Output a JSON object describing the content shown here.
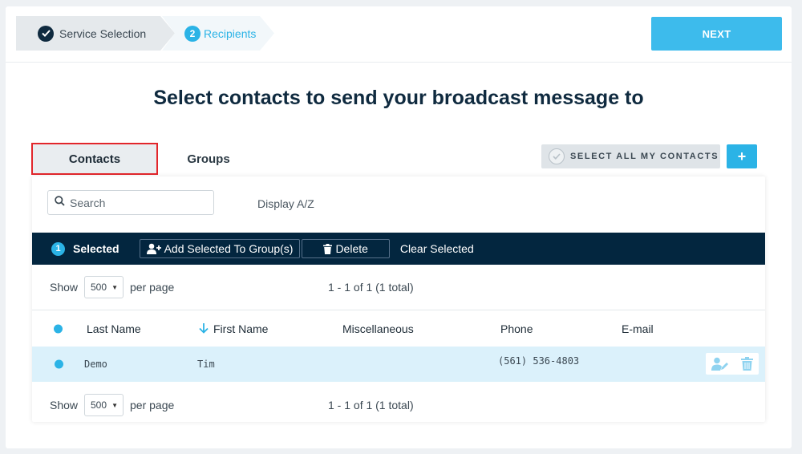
{
  "stepper": {
    "step1_label": "Service Selection",
    "step2_number": "2",
    "step2_label": "Recipients"
  },
  "header": {
    "next_label": "NEXT"
  },
  "title": "Select contacts to send your broadcast message to",
  "tabs": {
    "contacts": "Contacts",
    "groups": "Groups"
  },
  "select_all_label": "SELECT ALL MY CONTACTS",
  "plus_label": "+",
  "search": {
    "placeholder": "Search",
    "display_az": "Display A/Z"
  },
  "actionbar": {
    "selected_count": "1",
    "selected_label": "Selected",
    "add_to_group": "Add Selected To Group(s)",
    "delete": "Delete",
    "clear": "Clear Selected"
  },
  "pager": {
    "show": "Show",
    "per_page_value": "500",
    "per_page": "per page",
    "range": "1 - 1 of 1 (1 total)"
  },
  "table": {
    "columns": [
      "Last Name",
      "First Name",
      "Miscellaneous",
      "Phone",
      "E-mail"
    ],
    "rows": [
      {
        "last": "Demo",
        "first": "Tim",
        "misc": "",
        "phone": "(561) 536-4803",
        "email": ""
      }
    ]
  },
  "colors": {
    "accent": "#2bb3e6",
    "navy": "#03263f",
    "row_highlight": "#dbf1fb",
    "tab_outline": "#e2262b"
  },
  "icons": [
    "check-icon",
    "search-icon",
    "add-user-icon",
    "trash-icon",
    "sort-arrow-down-icon",
    "caret-down-icon",
    "edit-user-icon"
  ]
}
